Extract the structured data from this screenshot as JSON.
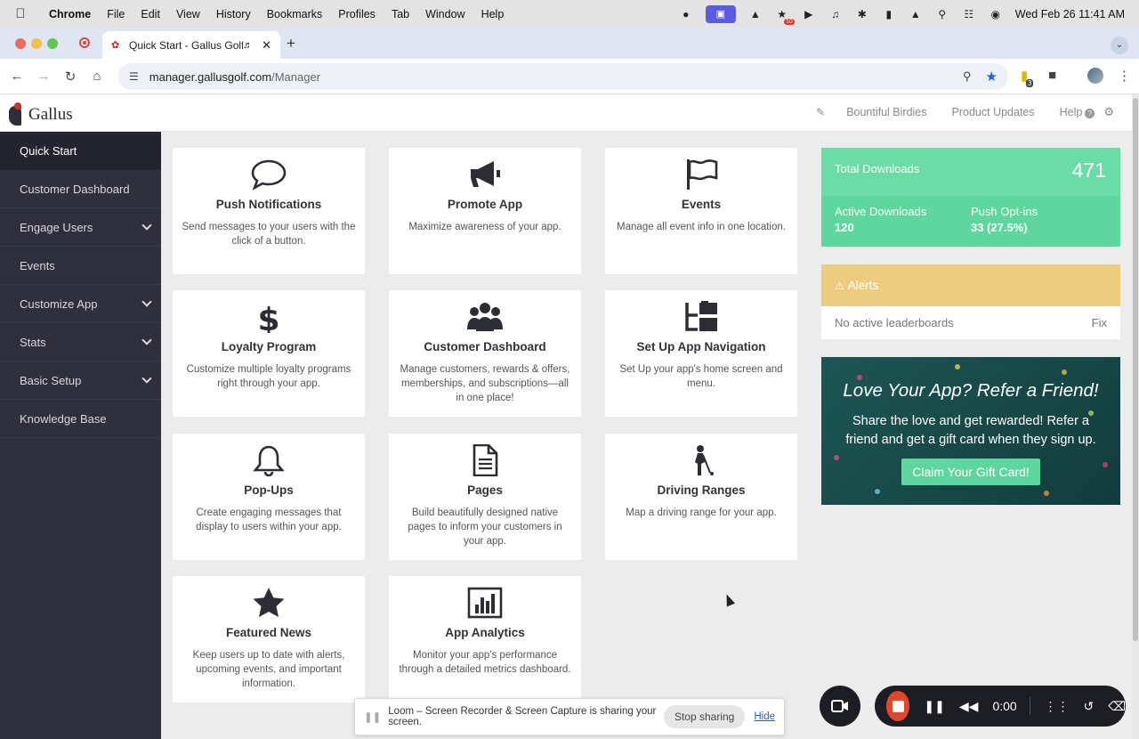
{
  "menubar": {
    "items": [
      "Chrome",
      "File",
      "Edit",
      "View",
      "History",
      "Bookmarks",
      "Profiles",
      "Tab",
      "Window",
      "Help"
    ],
    "datetime": "Wed Feb 26  11:41 AM"
  },
  "browser": {
    "tab_title": "Quick Start - Gallus Golf",
    "url_host": "manager.gallusgolf.com",
    "url_path": "/Manager"
  },
  "header": {
    "logo_text": "Gallus",
    "links": [
      "Bountiful Birdies",
      "Product Updates",
      "Help"
    ]
  },
  "sidebar": {
    "items": [
      {
        "label": "Quick Start"
      },
      {
        "label": "Customer Dashboard"
      },
      {
        "label": "Engage Users"
      },
      {
        "label": "Events"
      },
      {
        "label": "Customize App"
      },
      {
        "label": "Stats"
      },
      {
        "label": "Basic Setup"
      },
      {
        "label": "Knowledge Base"
      }
    ]
  },
  "cards": [
    {
      "title": "Push Notifications",
      "desc": "Send messages to your users with the click of a button.",
      "icon": "speech-bubble-icon"
    },
    {
      "title": "Promote App",
      "desc": "Maximize awareness of your app.",
      "icon": "megaphone-icon"
    },
    {
      "title": "Events",
      "desc": "Manage all event info in one location.",
      "icon": "flag-icon"
    },
    {
      "title": "Loyalty Program",
      "desc": "Customize multiple loyalty programs right through your app.",
      "icon": "dollar-icon"
    },
    {
      "title": "Customer Dashboard",
      "desc": "Manage customers, rewards & offers, memberships, and subscriptions—all in one place!",
      "icon": "users-icon"
    },
    {
      "title": "Set Up App Navigation",
      "desc": "Set Up your app's home screen and menu.",
      "icon": "sitemap-icon"
    },
    {
      "title": "Pop-Ups",
      "desc": "Create engaging messages that display to users within your app.",
      "icon": "bell-icon"
    },
    {
      "title": "Pages",
      "desc": "Build beautifully designed native pages to inform your customers in your app.",
      "icon": "document-icon"
    },
    {
      "title": "Driving Ranges",
      "desc": "Map a driving range for your app.",
      "icon": "golfer-icon"
    },
    {
      "title": "Featured News",
      "desc": "Keep users up to date with alerts, upcoming events, and important information.",
      "icon": "star-icon"
    },
    {
      "title": "App Analytics",
      "desc": "Monitor your app's performance through a detailed metrics dashboard.",
      "icon": "bar-chart-icon"
    }
  ],
  "stats": {
    "total_label": "Total Downloads",
    "total_value": "471",
    "active_label": "Active Downloads",
    "active_value": "120",
    "optin_label": "Push Opt-ins",
    "optin_value": "33 (27.5%)"
  },
  "alerts": {
    "title": "Alerts",
    "message": "No active leaderboards",
    "action": "Fix"
  },
  "promo": {
    "title": "Love Your App? Refer a Friend!",
    "text": "Share the love and get rewarded! Refer a friend and get a gift card when they sign up.",
    "button": "Claim Your Gift Card!"
  },
  "loom": {
    "share_message": "Loom – Screen Recorder & Screen Capture is sharing your screen.",
    "stop_label": "Stop sharing",
    "hide_label": "Hide",
    "timer": "0:00"
  },
  "colors": {
    "sidebar_bg": "#2f2f3d",
    "stats_green": "#5ed69d",
    "alerts_yellow": "#eccd80",
    "promo_teal": "#174948",
    "loom_red": "#e0472c"
  }
}
